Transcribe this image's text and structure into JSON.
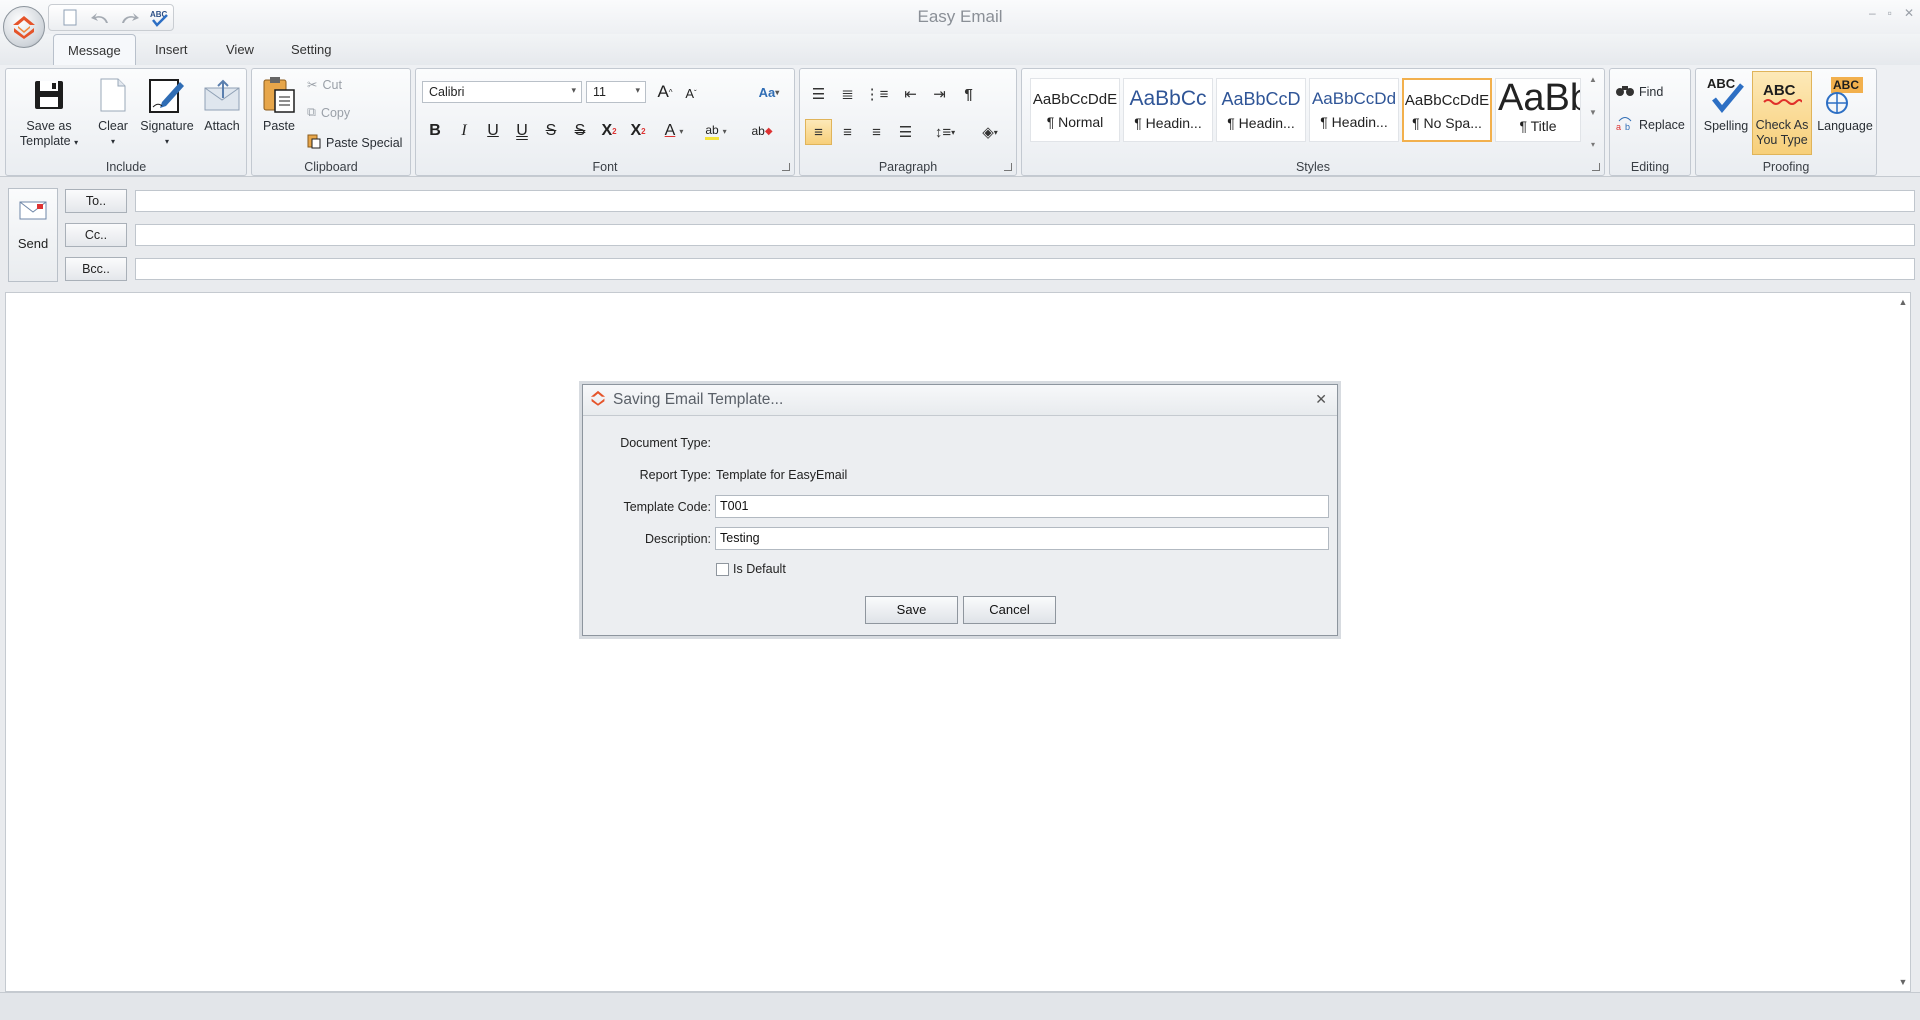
{
  "app": {
    "title": "Easy Email",
    "accent": "#f2b04d",
    "logo_icon": "easyemail-logo-icon"
  },
  "quick_access": [
    "new-document-icon",
    "undo-icon",
    "redo-icon",
    "spell-check-icon"
  ],
  "tabs": [
    {
      "label": "Message",
      "active": true
    },
    {
      "label": "Insert"
    },
    {
      "label": "View"
    },
    {
      "label": "Setting"
    }
  ],
  "ribbon": {
    "include": {
      "label": "Include",
      "save_as_template_1": "Save as",
      "save_as_template_2": "Template",
      "clear": "Clear",
      "signature": "Signature",
      "attach": "Attach"
    },
    "clipboard": {
      "label": "Clipboard",
      "paste": "Paste",
      "cut": "Cut",
      "copy": "Copy",
      "paste_special": "Paste Special"
    },
    "font": {
      "label": "Font",
      "family": "Calibri",
      "size": "11",
      "grow": "A",
      "shrink": "A",
      "change_case": "Aa",
      "bold": "B",
      "italic": "I",
      "underline": "U",
      "double_underline": "U",
      "strike": "S",
      "double_strike": "S",
      "superscript": "X",
      "subscript": "X",
      "font_color": "A",
      "highlight": "ab",
      "clear_format": "ab"
    },
    "paragraph": {
      "label": "Paragraph"
    },
    "styles": {
      "label": "Styles",
      "items": [
        {
          "sample": "AaBbCcDdE",
          "name": "¶ Normal"
        },
        {
          "sample": "AaBbCc",
          "name": "¶ Headin..."
        },
        {
          "sample": "AaBbCcD",
          "name": "¶ Headin..."
        },
        {
          "sample": "AaBbCcDd",
          "name": "¶ Headin..."
        },
        {
          "sample": "AaBbCcDdE",
          "name": "¶ No Spa..."
        },
        {
          "sample": "AaBb",
          "name": "¶ Title"
        }
      ]
    },
    "editing": {
      "label": "Editing",
      "find": "Find",
      "replace": "Replace"
    },
    "proofing": {
      "label": "Proofing",
      "spelling": "Spelling",
      "check_1": "Check As",
      "check_2": "You Type",
      "language": "Language",
      "abc": "ABC"
    }
  },
  "compose": {
    "send": "Send",
    "to": "To..",
    "cc": "Cc..",
    "bcc": "Bcc.."
  },
  "dialog": {
    "title": "Saving Email Template...",
    "document_type_label": "Document Type:",
    "document_type_value": "",
    "report_type_label": "Report Type:",
    "report_type_value": "Template for EasyEmail",
    "template_code_label": "Template Code:",
    "template_code_value": "T001",
    "description_label": "Description:",
    "description_value": "Testing",
    "is_default_label": "Is Default",
    "is_default_checked": false,
    "save": "Save",
    "cancel": "Cancel"
  }
}
